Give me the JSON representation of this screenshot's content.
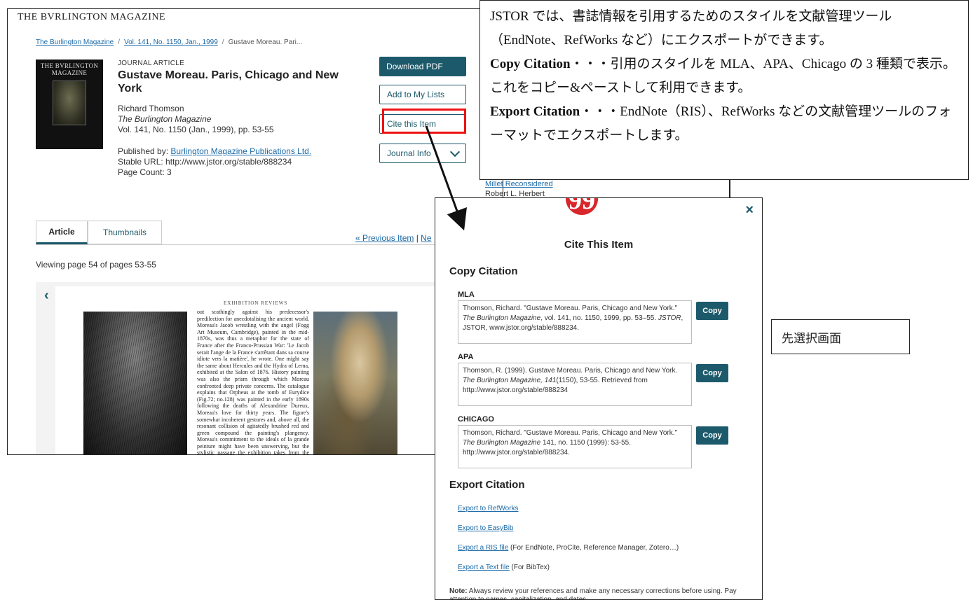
{
  "jstor": {
    "magazine_title": "THE BVRLINGTON MAGAZINE",
    "breadcrumbs": [
      "The Burlington Magazine",
      "Vol. 141, No. 1150, Jan., 1999",
      "Gustave Moreau. Pari..."
    ],
    "cover_title": "THE BVRLINGTON MAGAZINE",
    "article_type": "JOURNAL ARTICLE",
    "article_title": "Gustave Moreau. Paris, Chicago and New York",
    "author": "Richard Thomson",
    "journal": "The Burlington Magazine",
    "volume_line": "Vol. 141, No. 1150 (Jan., 1999), pp. 53-55",
    "published_by_label": "Published by:",
    "publisher": "Burlington Magazine Publications Ltd.",
    "stable_url": "Stable URL: http://www.jstor.org/stable/888234",
    "page_count": "Page Count: 3",
    "buttons": {
      "download": "Download PDF",
      "add_list": "Add to My Lists",
      "cite": "Cite this Item",
      "journal_info": "Journal Info"
    },
    "tabs": [
      "Article",
      "Thumbnails"
    ],
    "prev_item": "« Previous Item",
    "next_item": "Ne",
    "viewing": "Viewing page 54 of pages 53-55",
    "running_head": "EXHIBITION REVIEWS",
    "page_body": "out scathingly against his predecessor's predilection for anecdotalising the ancient world. Moreau's Jacob wrestling with the angel (Fogg Art Museum, Cambridge), painted in the mid-1870s, was thus a metaphor for the state of France after the Franco-Prussian War: 'Le Jacob serait l'ange de la France s'arrêtant dans sa course idiote vers la matière', he wrote. One might say the same about Hercules and the Hydra of Lerna, exhibited at the Salon of 1876. History painting was also the prism through which Moreau confronted deep private concerns. The catalogue explains that Orpheus at the tomb of Eurydice (Fig.72; no.128) was painted in the early 1890s following the deaths of Alexandrine Dureux, Moreau's love for thirty years. The figure's somewhat incoherent gestures and, above all, the resonant collision of agitatedly brushed red and green compound the painting's plangency. Moreau's commitment to the ideals of la grande peinture might have been unswerving, but the stylistic passage the exhibition takes from the modeled figure"
  },
  "sidebar": {
    "link": "Millet Reconsidered",
    "author": "Robert L. Herbert"
  },
  "callout": {
    "line1": "JSTOR では、書誌情報を引用するためのスタイルを文献管理ツール（EndNote、RefWorks など）にエクスポートができます。",
    "copy_label": "Copy Citation",
    "copy_text": "・・・引用のスタイルを MLA、APA、Chicago の 3 種類で表示。これをコピー&ペーストして利用できます。",
    "export_label": "Export Citation",
    "export_text": "・・・EndNote（RIS）、RefWorks などの文献管理ツールのフォーマットでエクスポートします。"
  },
  "modal": {
    "badge": "99",
    "close": "×",
    "title": "Cite This Item",
    "copy_heading": "Copy Citation",
    "copy_button": "Copy",
    "styles": [
      {
        "label": "MLA",
        "pre": "Thomson, Richard. \"Gustave Moreau. Paris, Chicago and New York.\" ",
        "italic": "The Burlington Magazine",
        "mid": ", vol. 141, no. 1150, 1999, pp. 53–55. ",
        "italic2": "JSTOR",
        "post": ", JSTOR, www.jstor.org/stable/888234."
      },
      {
        "label": "APA",
        "pre": "Thomson, R. (1999). Gustave Moreau. Paris, Chicago and New York. ",
        "italic": "The Burlington Magazine, 141",
        "mid": "(1150), 53-55. Retrieved from http://www.jstor.org/stable/888234",
        "italic2": "",
        "post": ""
      },
      {
        "label": "CHICAGO",
        "pre": "Thomson, Richard. \"Gustave Moreau. Paris, Chicago and New York.\" ",
        "italic": "The Burlington Magazine",
        "mid": " 141, no. 1150 (1999): 53-55. http://www.jstor.org/stable/888234.",
        "italic2": "",
        "post": ""
      }
    ],
    "export_heading": "Export Citation",
    "exports": [
      {
        "link": "Export to RefWorks",
        "desc": ""
      },
      {
        "link": "Export to EasyBib",
        "desc": ""
      },
      {
        "link": "Export a RIS file",
        "desc": " (For EndNote, ProCite, Reference Manager, Zotero…)"
      },
      {
        "link": "Export a Text file",
        "desc": " (For BibTex)"
      }
    ],
    "note_label": "Note:",
    "note_text": " Always review your references and make any necessary corrections before using. Pay attention to names, capitalization, and dates."
  },
  "screen_label": "先選択画面",
  "colors": {
    "accent": "#1c5a6b",
    "highlight": "#e11111",
    "badge": "#d9262c",
    "link": "#1b6aa8"
  }
}
